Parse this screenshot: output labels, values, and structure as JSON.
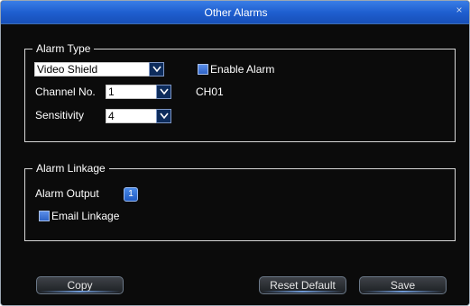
{
  "dialog": {
    "title": "Other Alarms",
    "close_label": "×"
  },
  "alarm_type": {
    "legend": "Alarm Type",
    "type_select": {
      "value": "Video Shield"
    },
    "enable_alarm": {
      "label": "Enable Alarm",
      "checked": true
    },
    "channel": {
      "label": "Channel No.",
      "value": "1",
      "name": "CH01"
    },
    "sensitivity": {
      "label": "Sensitivity",
      "value": "4"
    }
  },
  "alarm_linkage": {
    "legend": "Alarm Linkage",
    "alarm_output": {
      "label": "Alarm Output",
      "value": "1"
    },
    "email_linkage": {
      "label": "Email Linkage",
      "checked": true
    }
  },
  "buttons": {
    "copy": "Copy",
    "reset_default": "Reset Default",
    "save": "Save"
  },
  "colors": {
    "title_bar": "#1f5fd0",
    "background": "#0b0b0b",
    "accent": "#3a74d8"
  }
}
